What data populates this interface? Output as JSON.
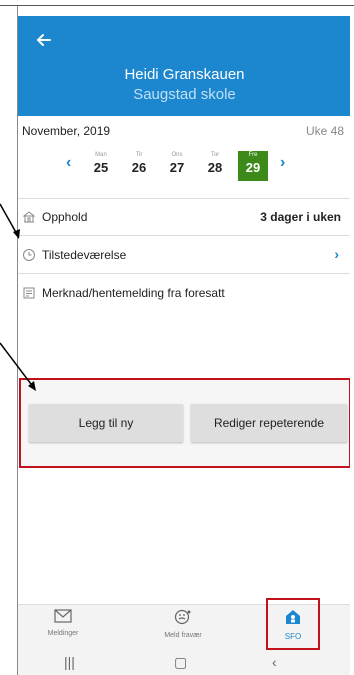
{
  "header": {
    "student_name": "Heidi Granskauen",
    "school": "Saugstad skole"
  },
  "calendar": {
    "month": "November, 2019",
    "week": "Uke 48",
    "days": [
      {
        "name": "Man",
        "date": "25"
      },
      {
        "name": "Tir",
        "date": "26"
      },
      {
        "name": "Ons",
        "date": "27"
      },
      {
        "name": "Tor",
        "date": "28"
      },
      {
        "name": "Fre",
        "date": "29"
      }
    ]
  },
  "rows": {
    "opphold_label": "Opphold",
    "opphold_value": "3 dager i uken",
    "tilstedevaerelse_label": "Tilstedeværelse",
    "merknad_label": "Merknad/hentemelding fra foresatt"
  },
  "buttons": {
    "add_new": "Legg til ny",
    "edit_repeating": "Rediger repeterende"
  },
  "tabs": [
    {
      "label": "Meldinger"
    },
    {
      "label": "Meld fravær"
    },
    {
      "label": "SFO"
    }
  ],
  "colors": {
    "accent": "#1c86cf",
    "selected_day": "#3c8a19",
    "highlight": "#c0131b"
  }
}
